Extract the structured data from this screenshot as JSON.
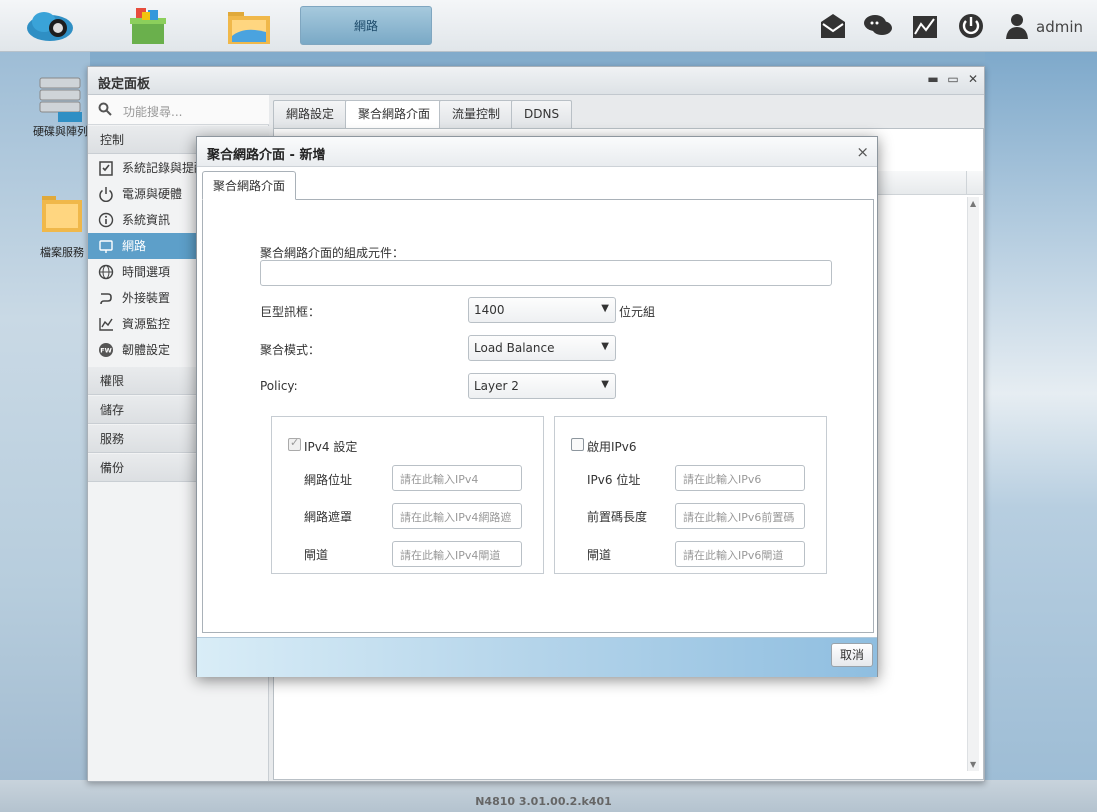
{
  "topbar": {
    "active_app_label": "網路",
    "user_label": "admin",
    "icons": [
      "cloud-app-icon",
      "app-store-icon",
      "file-folder-icon",
      "mail-icon",
      "chat-icon",
      "graph-icon",
      "power-icon",
      "user-icon"
    ]
  },
  "desktop": {
    "icon1_label": "硬碟與陣列",
    "icon2_label": "檔案服務"
  },
  "panel": {
    "title": "設定面板",
    "search_placeholder": "功能搜尋...",
    "section_control": "控制",
    "items": [
      {
        "label": "系統記錄與提醒",
        "icon": "checklist-icon"
      },
      {
        "label": "電源與硬體",
        "icon": "power-icon"
      },
      {
        "label": "系統資訊",
        "icon": "info-icon"
      },
      {
        "label": "網路",
        "icon": "network-icon",
        "active": true
      },
      {
        "label": "時間選項",
        "icon": "globe-icon"
      },
      {
        "label": "外接裝置",
        "icon": "usb-icon"
      },
      {
        "label": "資源監控",
        "icon": "chart-icon"
      },
      {
        "label": "韌體設定",
        "icon": "firmware-icon"
      }
    ],
    "sections": [
      "權限",
      "儲存",
      "服務",
      "備份"
    ],
    "tabs": [
      "網路設定",
      "聚合網路介面",
      "流量控制",
      "DDNS"
    ],
    "active_tab": "聚合網路介面"
  },
  "modal": {
    "title": "聚合網路介面 - 新增",
    "close_label": "×",
    "tab_label": "聚合網路介面",
    "components_label": "聚合網路介面的組成元件：",
    "components_value": "",
    "jumbo_label": "巨型訊框：",
    "jumbo_value": "1400",
    "jumbo_unit": "位元組",
    "mode_label": "聚合模式：",
    "mode_value": "Load Balance",
    "policy_label": "Policy:",
    "policy_value": "Layer 2",
    "ipv4": {
      "checkbox_label": "IPv4 設定",
      "checked": true,
      "address_label": "網路位址",
      "address_placeholder": "請在此輸入IPv4",
      "mask_label": "網路遮罩",
      "mask_placeholder": "請在此輸入IPv4網路遮",
      "gateway_label": "閘道",
      "gateway_placeholder": "請在此輸入IPv4閘道"
    },
    "ipv6": {
      "checkbox_label": "啟用IPv6",
      "checked": false,
      "address_label": "IPv6 位址",
      "address_placeholder": "請在此輸入IPv6",
      "prefix_label": "前置碼長度",
      "prefix_placeholder": "請在此輸入IPv6前置碼",
      "gateway_label": "閘道",
      "gateway_placeholder": "請在此輸入IPv6閘道"
    },
    "cancel_label": "取消"
  },
  "footer": {
    "version": "N4810   3.01.00.2.k401"
  }
}
